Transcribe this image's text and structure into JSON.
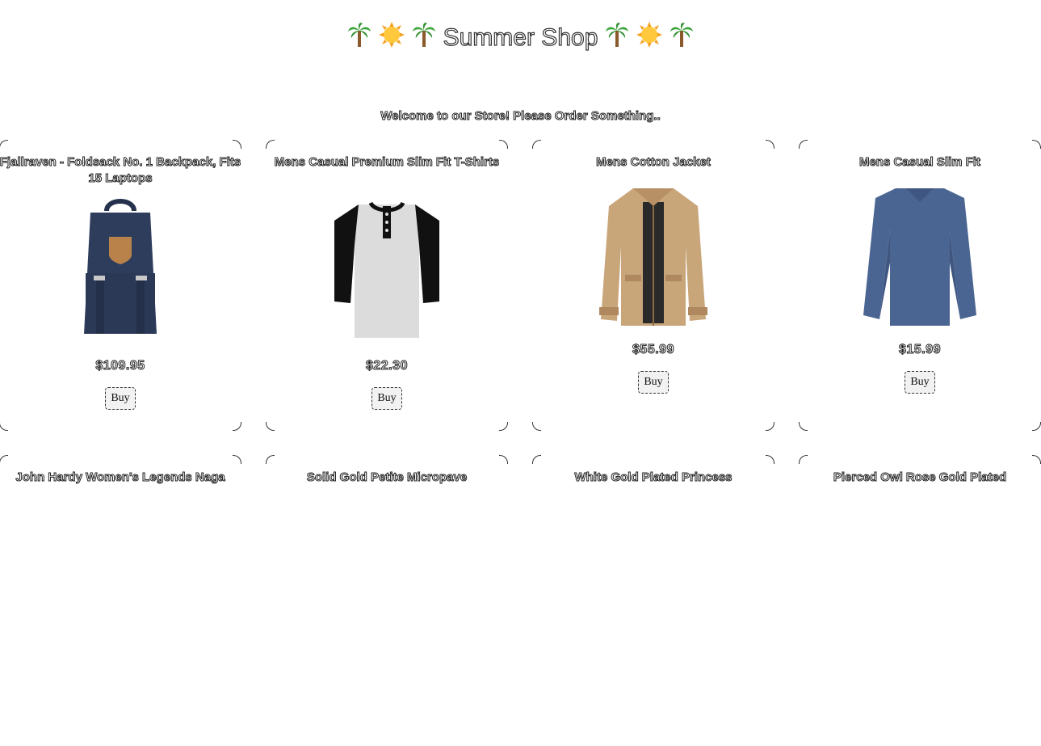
{
  "header": {
    "title": "Summer Shop",
    "left_icons": [
      "palm-tree-icon",
      "sun-icon",
      "palm-tree-icon"
    ],
    "right_icons": [
      "palm-tree-icon",
      "sun-icon",
      "palm-tree-icon"
    ]
  },
  "welcome": "Welcome to our Store! Please Order Something..",
  "products": [
    {
      "title": "Fjallraven - Foldsack No. 1 Backpack, Fits 15 Laptops",
      "price": "$109.95",
      "buy_label": "Buy",
      "image": "backpack"
    },
    {
      "title": "Mens Casual Premium Slim Fit T-Shirts",
      "price": "$22.30",
      "buy_label": "Buy",
      "image": "henley-shirt"
    },
    {
      "title": "Mens Cotton Jacket",
      "price": "$55.99",
      "buy_label": "Buy",
      "image": "cotton-jacket"
    },
    {
      "title": "Mens Casual Slim Fit",
      "price": "$15.99",
      "buy_label": "Buy",
      "image": "long-sleeve-shirt"
    },
    {
      "title": "John Hardy Women's Legends Naga"
    },
    {
      "title": "Solid Gold Petite Micropave"
    },
    {
      "title": "White Gold Plated Princess"
    },
    {
      "title": "Pierced Owl Rose Gold Plated"
    }
  ],
  "colors": {
    "text": "#222222",
    "button_bg": "#f2f2f2",
    "navy": "#2e3d5c",
    "jacket": "#c9a57a",
    "shirt_blue": "#4b6593"
  }
}
